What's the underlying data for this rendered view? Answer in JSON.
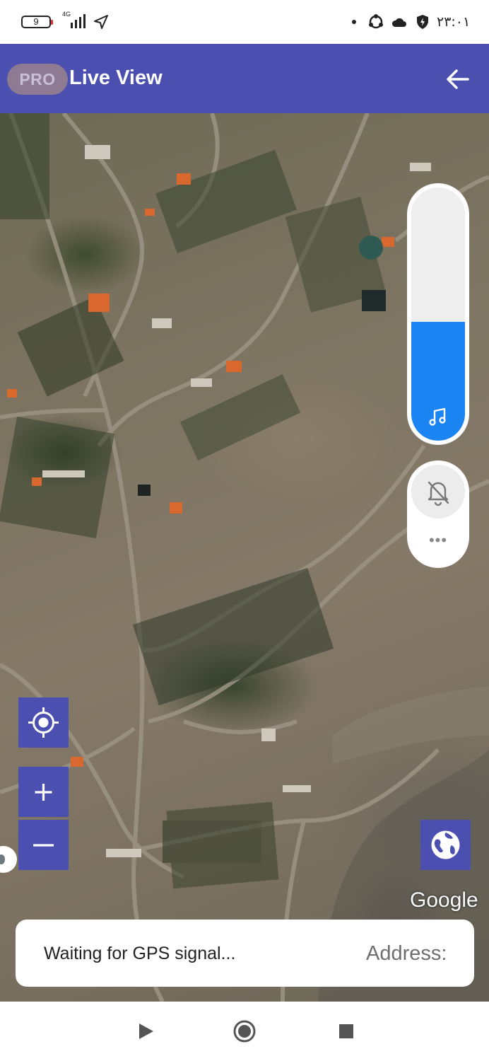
{
  "status_bar": {
    "battery": "9",
    "network": "4G",
    "time": "۲۳:۰۱"
  },
  "app_bar": {
    "pro_label": "PRO",
    "title": "Live View"
  },
  "volume": {
    "level_fraction": 0.47,
    "accent_color": "#1a84f2"
  },
  "map": {
    "attribution": "Google",
    "controls": [
      "locate-icon",
      "zoom-in-icon",
      "zoom-out-icon",
      "globe-icon"
    ]
  },
  "address_card": {
    "status": "Waiting for GPS signal...",
    "address_label": "Address:"
  },
  "nav_bar": {
    "buttons": [
      "back-triangle-icon",
      "home-circle-icon",
      "recents-square-icon"
    ]
  },
  "colors": {
    "app_bar": "#4a4fb0",
    "pro_badge": "#8e7b93"
  }
}
